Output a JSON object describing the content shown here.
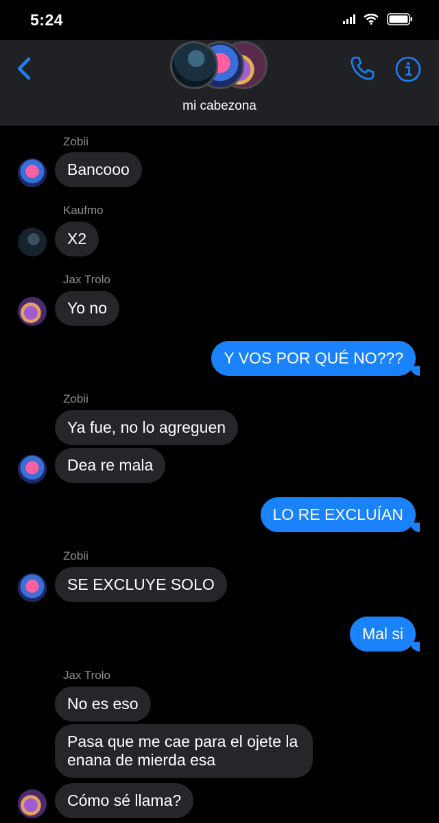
{
  "status": {
    "time": "5:24"
  },
  "header": {
    "group_name": "mi cabezona"
  },
  "colors": {
    "accent": "#1a82fb",
    "incoming_bubble": "#26252a",
    "header_bg": "#202124"
  },
  "icons": [
    "back-chevron-icon",
    "phone-icon",
    "info-icon",
    "signal-icon",
    "wifi-icon",
    "battery-icon"
  ],
  "messages": [
    {
      "sender": "Zobii",
      "text": "Bancooo"
    },
    {
      "sender": "Kaufmo",
      "text": "X2"
    },
    {
      "sender": "Jax Trolo",
      "text": "Yo no"
    },
    {
      "sender": "",
      "text": "Y VOS POR QUÉ NO???"
    },
    {
      "sender": "Zobii",
      "text": "Ya fue, no lo agreguen"
    },
    {
      "sender": "Zobii",
      "text": "Dea re mala"
    },
    {
      "sender": "",
      "text": "LO RE EXCLUÍAN"
    },
    {
      "sender": "Zobii",
      "text": "SE EXCLUYE SOLO"
    },
    {
      "sender": "",
      "text": "Mal si"
    },
    {
      "sender": "Jax Trolo",
      "text": "No es eso"
    },
    {
      "sender": "Jax Trolo",
      "text": "Pasa que me cae para el ojete la enana de mierda esa"
    },
    {
      "sender": "Jax Trolo",
      "text": "Cómo sé llama?"
    }
  ]
}
